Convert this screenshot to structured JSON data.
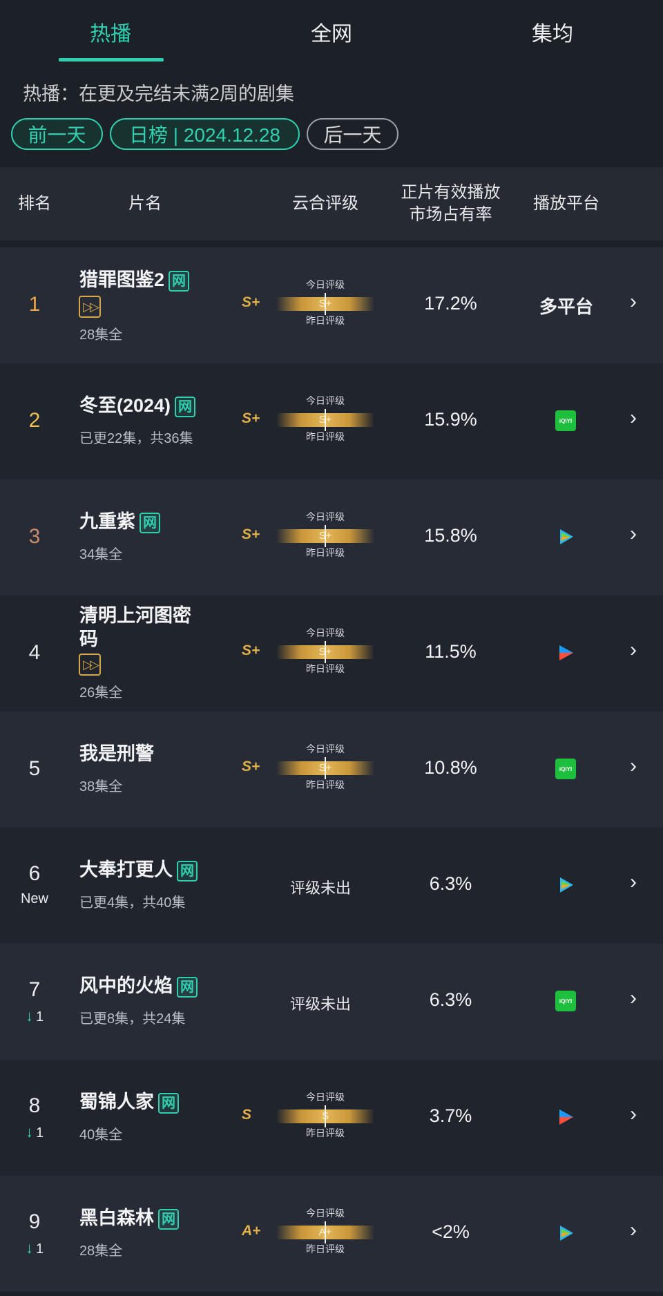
{
  "tabs": [
    "热播",
    "全网",
    "集均"
  ],
  "subtitle": "热播：在更及完结未满2周的剧集",
  "date_nav": {
    "prev": "前一天",
    "current": "日榜 | 2024.12.28",
    "next": "后一天"
  },
  "header": {
    "rank": "排名",
    "title": "片名",
    "grade": "云合评级",
    "share_line1": "正片有效播放",
    "share_line2": "市场占有率",
    "platform": "播放平台"
  },
  "grade_labels": {
    "today": "今日评级",
    "yesterday": "昨日评级",
    "none": "评级未出"
  },
  "chevron": "›",
  "net_badge": "网",
  "play_badge": "▷▷",
  "rows": [
    {
      "rank": "1",
      "rank_color": "#f0a64a",
      "title_line1": "猎罪图鉴2",
      "title_line2": "",
      "net": true,
      "play_badge": true,
      "eps": "28集全",
      "grade": "S+",
      "grade_bar": "S+",
      "share": "17.2%",
      "platform_text": "多平台",
      "platform_icon": ""
    },
    {
      "rank": "2",
      "rank_color": "#f0c050",
      "title_line1": "冬至(2024)",
      "title_line2": "",
      "net": true,
      "play_badge": false,
      "eps": "已更22集，共36集",
      "grade": "S+",
      "grade_bar": "S+",
      "share": "15.9%",
      "platform_text": "",
      "platform_icon": "iqiyi"
    },
    {
      "rank": "3",
      "rank_color": "#c98e6e",
      "title_line1": "九重紫",
      "title_line2": "",
      "net": true,
      "play_badge": false,
      "eps": "34集全",
      "grade": "S+",
      "grade_bar": "S+",
      "share": "15.8%",
      "platform_text": "",
      "platform_icon": "tencent"
    },
    {
      "rank": "4",
      "rank_color": "#e9ecef",
      "title_line1": "清明上河图密",
      "title_line2": "码",
      "net": false,
      "play_badge": true,
      "eps": "26集全",
      "grade": "S+",
      "grade_bar": "S+",
      "share": "11.5%",
      "platform_text": "",
      "platform_icon": "youku"
    },
    {
      "rank": "5",
      "rank_color": "#e9ecef",
      "title_line1": "我是刑警",
      "title_line2": "",
      "net": false,
      "play_badge": false,
      "eps": "38集全",
      "grade": "S+",
      "grade_bar": "S+",
      "share": "10.8%",
      "platform_text": "",
      "platform_icon": "iqiyi"
    },
    {
      "rank": "6",
      "rank_color": "#e9ecef",
      "rank_sub": "New",
      "title_line1": "大奉打更人",
      "title_line2": "",
      "net": true,
      "play_badge": false,
      "eps": "已更4集，共40集",
      "grade": "",
      "grade_bar": "",
      "share": "6.3%",
      "platform_text": "",
      "platform_icon": "tencent"
    },
    {
      "rank": "7",
      "rank_color": "#e9ecef",
      "rank_sub": "1",
      "rank_down": true,
      "title_line1": "风中的火焰",
      "title_line2": "",
      "net": true,
      "play_badge": false,
      "eps": "已更8集，共24集",
      "grade": "",
      "grade_bar": "",
      "share": "6.3%",
      "platform_text": "",
      "platform_icon": "iqiyi"
    },
    {
      "rank": "8",
      "rank_color": "#e9ecef",
      "rank_sub": "1",
      "rank_down": true,
      "title_line1": "蜀锦人家",
      "title_line2": "",
      "net": true,
      "play_badge": false,
      "eps": "40集全",
      "grade": "S",
      "grade_bar": "S",
      "share": "3.7%",
      "platform_text": "",
      "platform_icon": "youku"
    },
    {
      "rank": "9",
      "rank_color": "#e9ecef",
      "rank_sub": "1",
      "rank_down": true,
      "title_line1": "黑白森林",
      "title_line2": "",
      "net": true,
      "play_badge": false,
      "eps": "28集全",
      "grade": "A+",
      "grade_bar": "A+",
      "share": "<2%",
      "platform_text": "",
      "platform_icon": "tencent"
    }
  ],
  "colors": {
    "accent": "#2fd0b0",
    "gold": "#e2b04a",
    "bg": "#1c2027"
  },
  "icons": {
    "iqiyi": "iqiyi-logo-icon",
    "tencent": "tencent-video-logo-icon",
    "youku": "youku-logo-icon"
  },
  "iqiyi_text": "iQIYI"
}
